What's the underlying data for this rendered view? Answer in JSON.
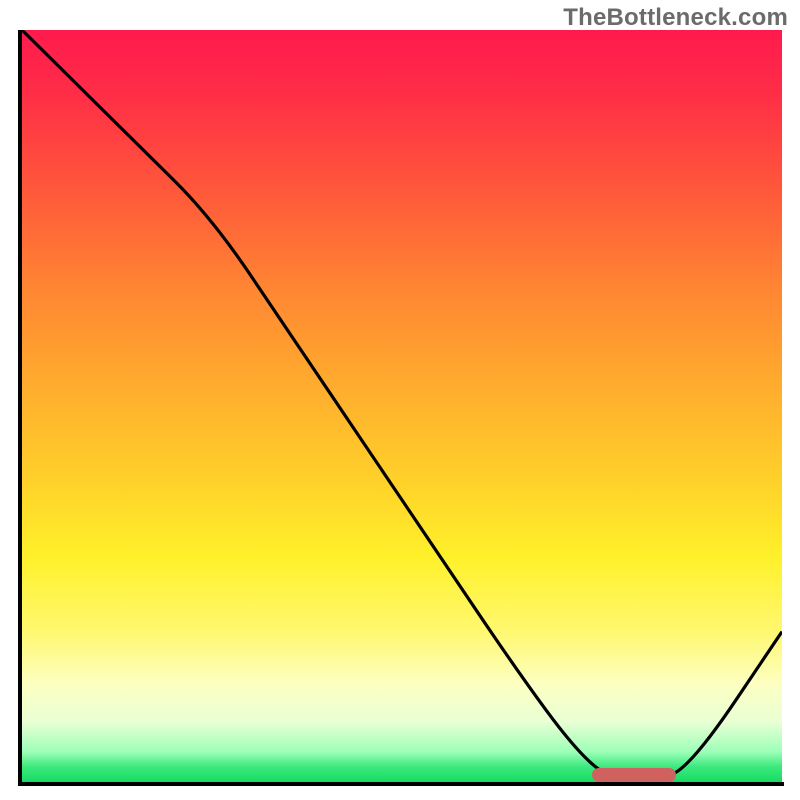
{
  "watermark": "TheBottleneck.com",
  "colors": {
    "axis": "#000000",
    "line": "#000000",
    "marker": "#cf615f",
    "gradient_top": "#ff1a4d",
    "gradient_bottom": "#17db63"
  },
  "chart_data": {
    "type": "line",
    "title": "",
    "xlabel": "",
    "ylabel": "",
    "xlim": [
      0,
      100
    ],
    "ylim": [
      0,
      100
    ],
    "x": [
      0,
      5,
      15,
      25,
      35,
      45,
      55,
      65,
      73,
      78,
      83,
      88,
      100
    ],
    "values": [
      100,
      95,
      85,
      75,
      60,
      45,
      30,
      15,
      4,
      0,
      0,
      2,
      20
    ],
    "marker": {
      "x_start": 75,
      "x_end": 86,
      "y": 0
    },
    "note": "Curve descends from top-left, flattens briefly near x≈25, reaches minimum (0) around x≈78-83 where the red marker sits, then rises toward the right edge."
  }
}
